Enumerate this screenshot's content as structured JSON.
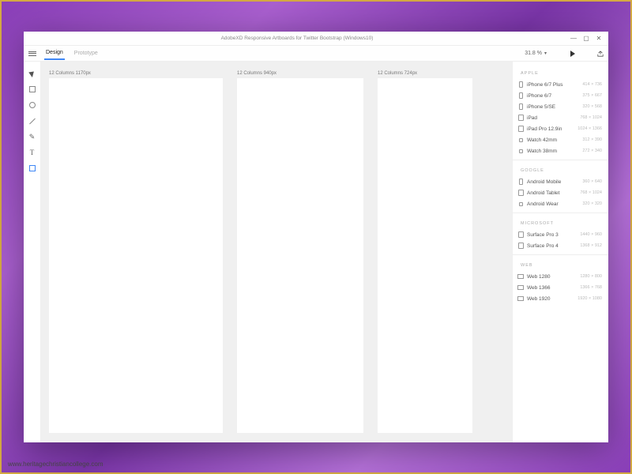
{
  "watermark": "www.heritagechristiancollege.com",
  "titlebar": {
    "title": "AdobeXD Responsive Artboards  for Twitter Bootstrap (Windows10)"
  },
  "toolbar": {
    "tabs": {
      "design": "Design",
      "prototype": "Prototype"
    },
    "zoom": "31.8 %"
  },
  "tools": [
    {
      "name": "select-tool",
      "icon": "ico-select"
    },
    {
      "name": "rectangle-tool",
      "icon": "ico-rect"
    },
    {
      "name": "ellipse-tool",
      "icon": "ico-ellipse"
    },
    {
      "name": "line-tool",
      "icon": "ico-line"
    },
    {
      "name": "pen-tool",
      "icon": "ico-pen"
    },
    {
      "name": "text-tool",
      "icon": "ico-text"
    },
    {
      "name": "artboard-tool",
      "icon": "ico-artboard",
      "active": true
    }
  ],
  "artboards": [
    {
      "label": "12 Columns 1170px"
    },
    {
      "label": "12 Columns 940px"
    },
    {
      "label": "12 Columns 724px"
    }
  ],
  "panel": {
    "groups": [
      {
        "header": "APPLE",
        "items": [
          {
            "name": "iPhone 6/7 Plus",
            "dim": "414 × 736",
            "icon": "ico-phone"
          },
          {
            "name": "iPhone 6/7",
            "dim": "375 × 667",
            "icon": "ico-phone"
          },
          {
            "name": "iPhone 5/SE",
            "dim": "320 × 568",
            "icon": "ico-phone"
          },
          {
            "name": "iPad",
            "dim": "768 × 1024",
            "icon": "ico-tablet"
          },
          {
            "name": "iPad Pro 12.9in",
            "dim": "1024 × 1366",
            "icon": "ico-tablet"
          },
          {
            "name": "Watch 42mm",
            "dim": "312 × 390",
            "icon": "ico-watch"
          },
          {
            "name": "Watch 38mm",
            "dim": "272 × 340",
            "icon": "ico-watch"
          }
        ]
      },
      {
        "header": "GOOGLE",
        "items": [
          {
            "name": "Android Mobile",
            "dim": "360 × 640",
            "icon": "ico-phone"
          },
          {
            "name": "Android Tablet",
            "dim": "768 × 1024",
            "icon": "ico-tablet"
          },
          {
            "name": "Android Wear",
            "dim": "320 × 320",
            "icon": "ico-watch"
          }
        ]
      },
      {
        "header": "MICROSOFT",
        "items": [
          {
            "name": "Surface Pro 3",
            "dim": "1440 × 960",
            "icon": "ico-tablet"
          },
          {
            "name": "Surface Pro 4",
            "dim": "1368 × 912",
            "icon": "ico-tablet"
          }
        ]
      },
      {
        "header": "WEB",
        "items": [
          {
            "name": "Web 1280",
            "dim": "1280 × 800",
            "icon": "ico-web"
          },
          {
            "name": "Web 1366",
            "dim": "1366 × 768",
            "icon": "ico-web"
          },
          {
            "name": "Web 1920",
            "dim": "1920 × 1080",
            "icon": "ico-web"
          }
        ]
      }
    ]
  }
}
